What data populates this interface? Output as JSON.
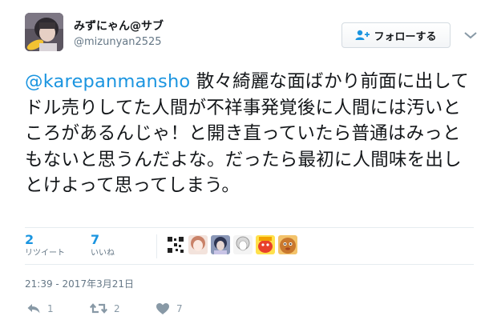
{
  "user": {
    "display_name": "みずにゃん@サブ",
    "handle": "@mizunyan2525"
  },
  "follow_button": {
    "label": "フォローする"
  },
  "tweet": {
    "mention": "@karepanmansho",
    "text": " 散々綺麗な面ばかり前面に出してドル売りしてた人間が不祥事発覚後に人間には汚いところがあるんじゃ！と開き直っていたら普通はみっともないと思うんだよな。だったら最初に人間味を出しとけよって思ってしまう。"
  },
  "stats": {
    "retweets": {
      "value": "2",
      "label": "リツイート"
    },
    "likes": {
      "value": "7",
      "label": "いいね"
    }
  },
  "timestamp": "21:39 - 2017年3月21日",
  "actions": {
    "reply": {
      "count": "1",
      "icon": "reply-icon"
    },
    "retweet": {
      "count": "2",
      "icon": "retweet-icon"
    },
    "like": {
      "count": "7",
      "icon": "heart-icon"
    }
  },
  "colors": {
    "link": "#1b95e0",
    "muted": "#657786",
    "text": "#14171a",
    "divider": "#e6ecf0"
  }
}
